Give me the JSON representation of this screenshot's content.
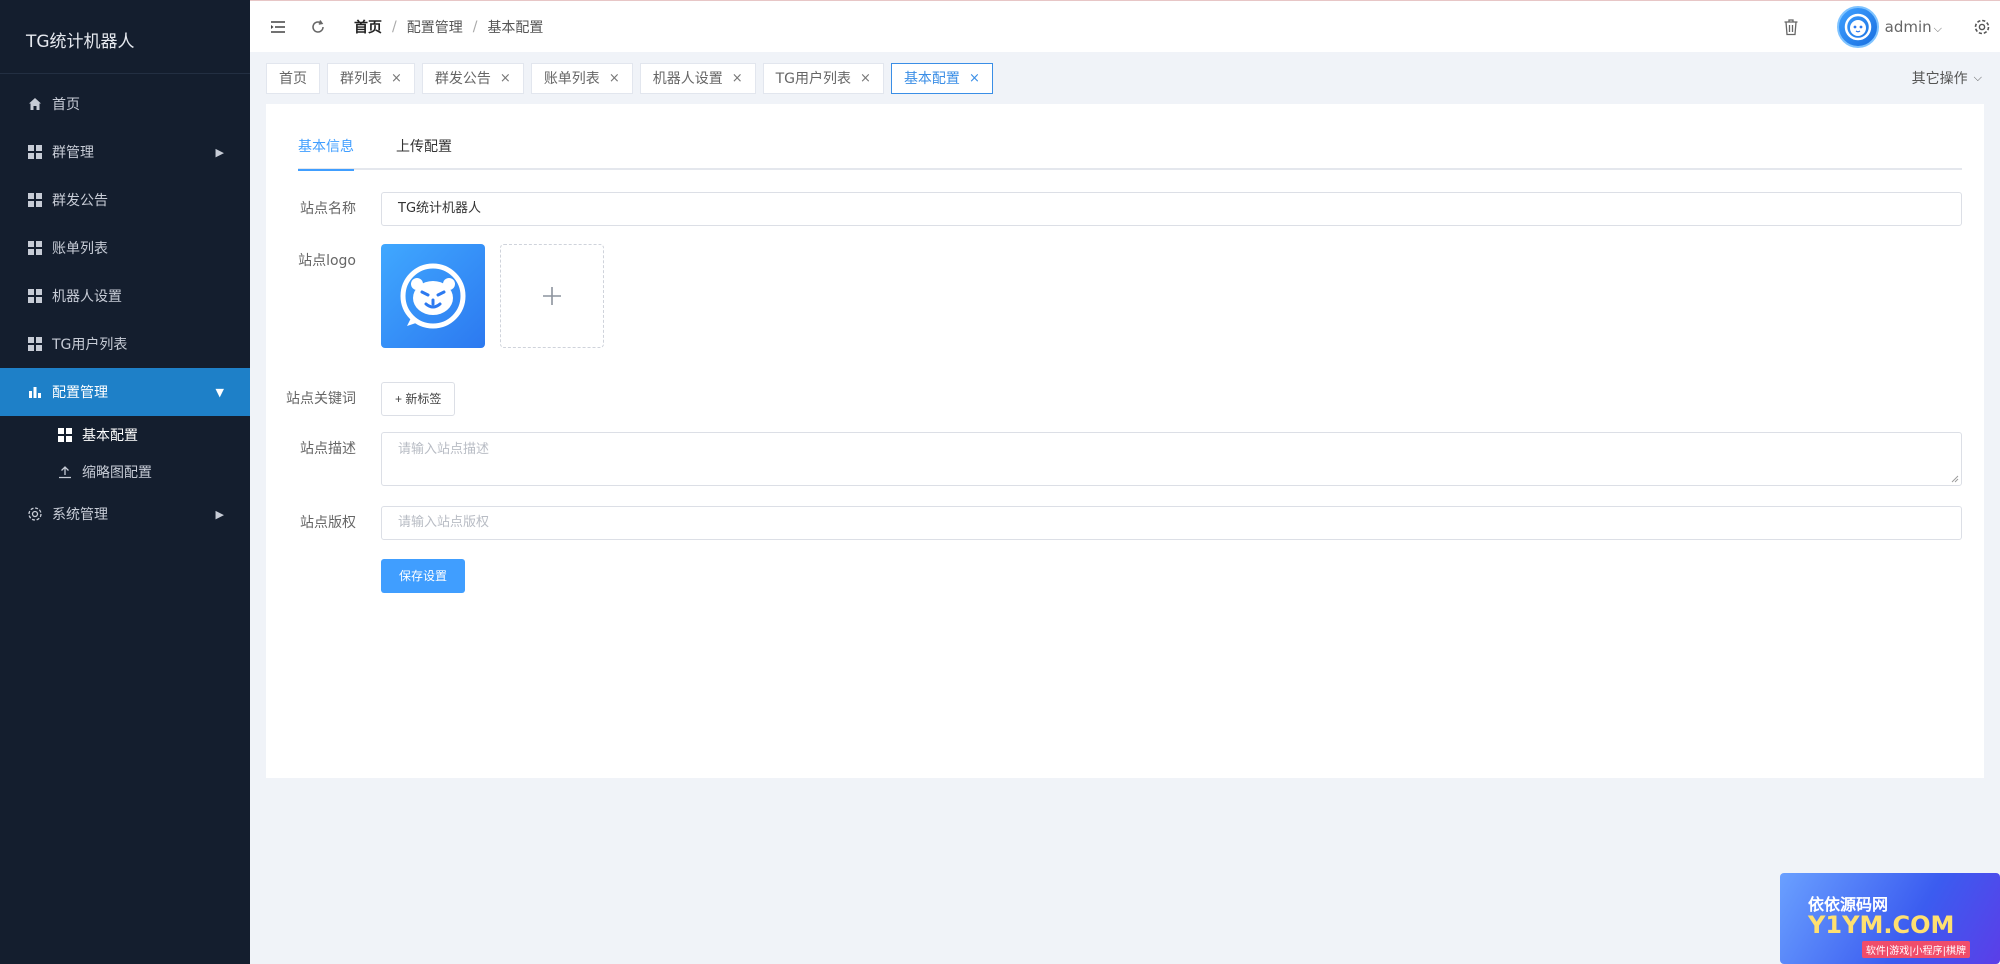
{
  "sidebar": {
    "brand": "TG统计机器人",
    "menu": {
      "home": "首页",
      "groups": "群管理",
      "announce": "群发公告",
      "bills": "账单列表",
      "robot": "机器人设置",
      "tgusers": "TG用户列表",
      "config": "配置管理",
      "system": "系统管理"
    },
    "submenu": {
      "basic": "基本配置",
      "thumb": "缩略图配置"
    }
  },
  "header": {
    "breadcrumb": [
      "首页",
      "配置管理",
      "基本配置"
    ],
    "breadcrumb_sep": "/",
    "user": "admin"
  },
  "tabs": [
    "首页",
    "群列表",
    "群发公告",
    "账单列表",
    "机器人设置",
    "TG用户列表",
    "基本配置"
  ],
  "tab_close": "×",
  "other_ops": "其它操作",
  "page": {
    "tabs": [
      "基本信息",
      "上传配置"
    ],
    "labels": {
      "site_name": "站点名称",
      "site_logo": "站点logo",
      "keywords": "站点关键词",
      "description": "站点描述",
      "copyright": "站点版权"
    },
    "site_name_value": "TG统计机器人",
    "new_tag": "+ 新标签",
    "description_placeholder": "请输入站点描述",
    "copyright_placeholder": "请输入站点版权",
    "save": "保存设置"
  },
  "watermark": {
    "top": "依依源码网",
    "main": "Y1YM.COM",
    "sub": "软件|游戏|小程序|棋牌"
  },
  "colors": {
    "sidebar_bg": "#141e2e",
    "active_menu": "#1e80c8",
    "primary": "#409eff"
  }
}
